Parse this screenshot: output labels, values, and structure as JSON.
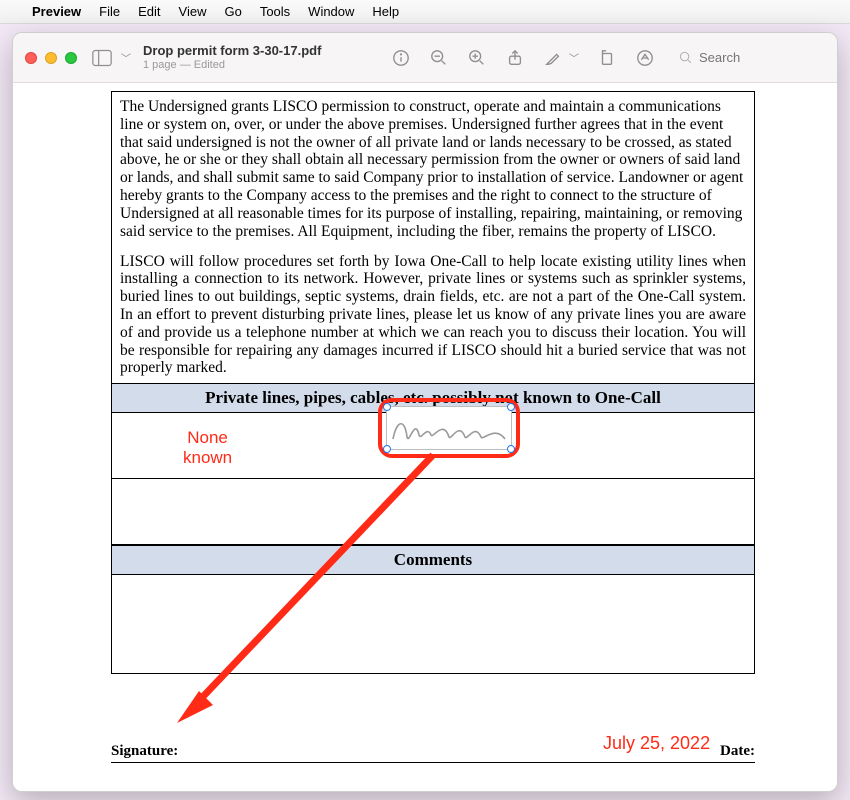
{
  "menubar": {
    "app": "Preview",
    "items": [
      "File",
      "Edit",
      "View",
      "Go",
      "Tools",
      "Window",
      "Help"
    ]
  },
  "window": {
    "title": "Drop permit form 3-30-17.pdf",
    "subtitle": "1 page — Edited",
    "search_placeholder": "Search"
  },
  "document": {
    "para1": "The Undersigned grants LISCO permission to construct, operate and maintain a communica­tions line or system on, over, or under the above premises. Undersigned further agrees that in the event that said undersigned is not the owner of all private land or lands necessary to be crossed, as stated above, he or she or they shall obtain all necessary permission from the owner or owners of said land or lands, and shall submit same to said Company prior to installation of service. Landowner or agent hereby grants to the Company access to the premises and the right to connect to the structure of Undersigned at all reasonable times for its purpose of installing, repairing, maintaining, or removing said service to the premises. All Equipment, including the fiber, remains the property of LISCO.",
    "para2": "LISCO will follow procedures set forth by Iowa One-Call to help locate existing utility lines when installing a connection to its network. However, private lines or systems such as sprinkler systems, buried lines to out buildings, septic systems, drain fields, etc. are not a part of the One-Call system. In an effort to prevent disturbing private lines, please let us know of any private lines you are aware of and provide us a telephone number at which we can reach you to discuss their location. You will be responsible for repairing any damages incurred if LISCO should hit a buried service that was not properly marked.",
    "header_private": "Private lines, pipes, cables, etc. possibly not known to One-Call",
    "header_comments": "Comments",
    "sig_label": "Signature:",
    "date_label": "Date:"
  },
  "annotations": {
    "none_known": "None\nknown",
    "date_value": "July 25, 2022"
  }
}
